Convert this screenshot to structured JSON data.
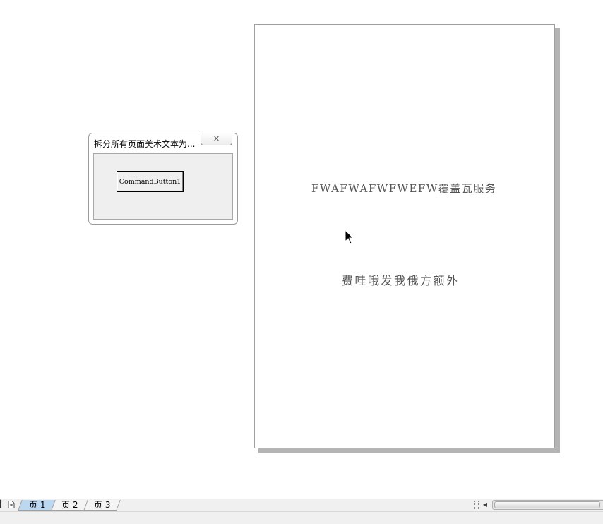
{
  "document": {
    "line1": "FWAFWAFWFWEFW覆盖瓦服务",
    "line2": "费哇哦发我俄方额外"
  },
  "dialog": {
    "title": "拆分所有页面美术文本为...",
    "close_glyph": "✕",
    "command_button_label": "CommandButton1"
  },
  "tabs": [
    {
      "label": "页 1",
      "active": true
    },
    {
      "label": "页 2",
      "active": false
    },
    {
      "label": "页 3",
      "active": false
    }
  ],
  "icons": {
    "first_page": "first-page-icon",
    "new_page": "new-page-icon",
    "scroll_left": "scroll-left-icon",
    "cursor": "mouse-cursor-icon"
  },
  "colors": {
    "active_tab": "#bcd7f0",
    "page_text": "#555555"
  }
}
